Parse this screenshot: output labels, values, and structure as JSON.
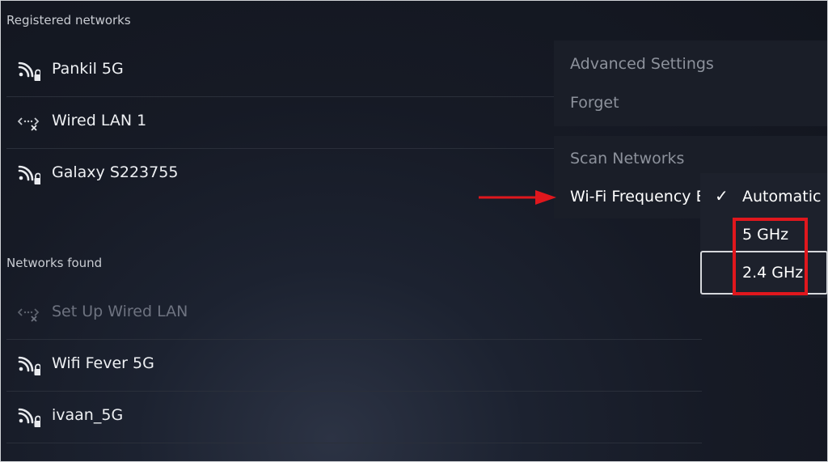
{
  "registered": {
    "title": "Registered networks",
    "items": [
      {
        "name": "Pankil 5G",
        "icon": "wifi-lock-icon"
      },
      {
        "name": "Wired LAN 1",
        "icon": "wired-disconnected-icon"
      },
      {
        "name": "Galaxy S223755",
        "icon": "wifi-lock-icon"
      }
    ]
  },
  "found": {
    "title": "Networks found",
    "items": [
      {
        "name": "Set Up Wired LAN",
        "icon": "wired-disconnected-icon",
        "dimmed": true
      },
      {
        "name": "Wifi Fever 5G",
        "icon": "wifi-lock-icon"
      },
      {
        "name": "ivaan_5G",
        "icon": "wifi-lock-icon"
      }
    ]
  },
  "context_menu": {
    "advanced": "Advanced Settings",
    "forget": "Forget",
    "scan": "Scan Networks",
    "frequency": "Wi-Fi Frequency B"
  },
  "frequency_menu": {
    "options": [
      "Automatic",
      "5 GHz",
      "2.4 GHz"
    ],
    "selected": "Automatic",
    "focused": "2.4 GHz"
  },
  "colors": {
    "annotation_red": "#e0171d",
    "background": "#161a25"
  }
}
